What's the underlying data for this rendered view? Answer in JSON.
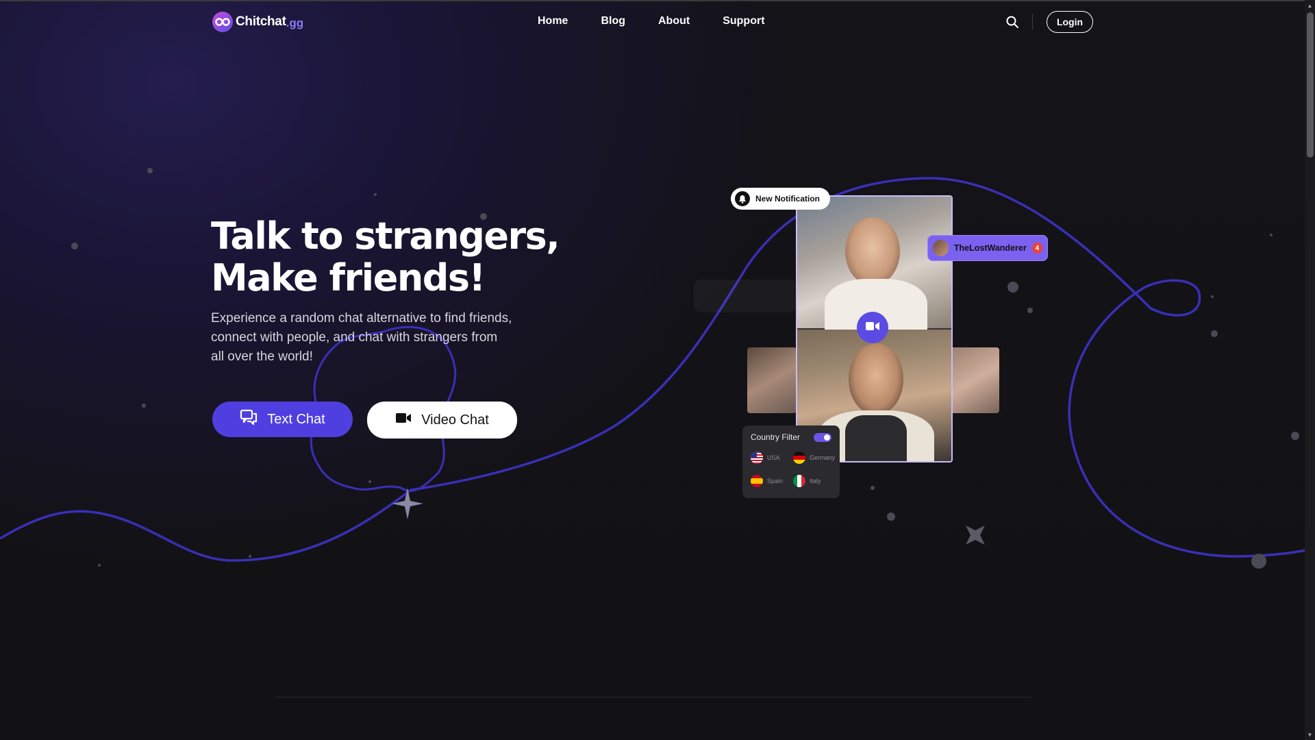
{
  "brand": {
    "name": "Chitchat",
    "tld": ".gg"
  },
  "nav": {
    "items": [
      "Home",
      "Blog",
      "About",
      "Support"
    ]
  },
  "header": {
    "login_label": "Login"
  },
  "hero": {
    "headline_line1": "Talk to strangers,",
    "headline_line2": "Make friends!",
    "subtitle": "Experience a random chat alternative to find friends, connect with people, and chat with strangers from all over the world!",
    "text_chat_label": "Text Chat",
    "video_chat_label": "Video Chat"
  },
  "illustration": {
    "notification_label": "New Notification",
    "user_chip": {
      "username": "TheLostWanderer",
      "count": "4"
    },
    "filter": {
      "title": "Country Filter",
      "countries": [
        "USA",
        "Germany",
        "Spain",
        "Italy"
      ]
    }
  },
  "colors": {
    "accent": "#4f3fe0",
    "accent_light": "#7b61f0",
    "background": "#121214"
  }
}
